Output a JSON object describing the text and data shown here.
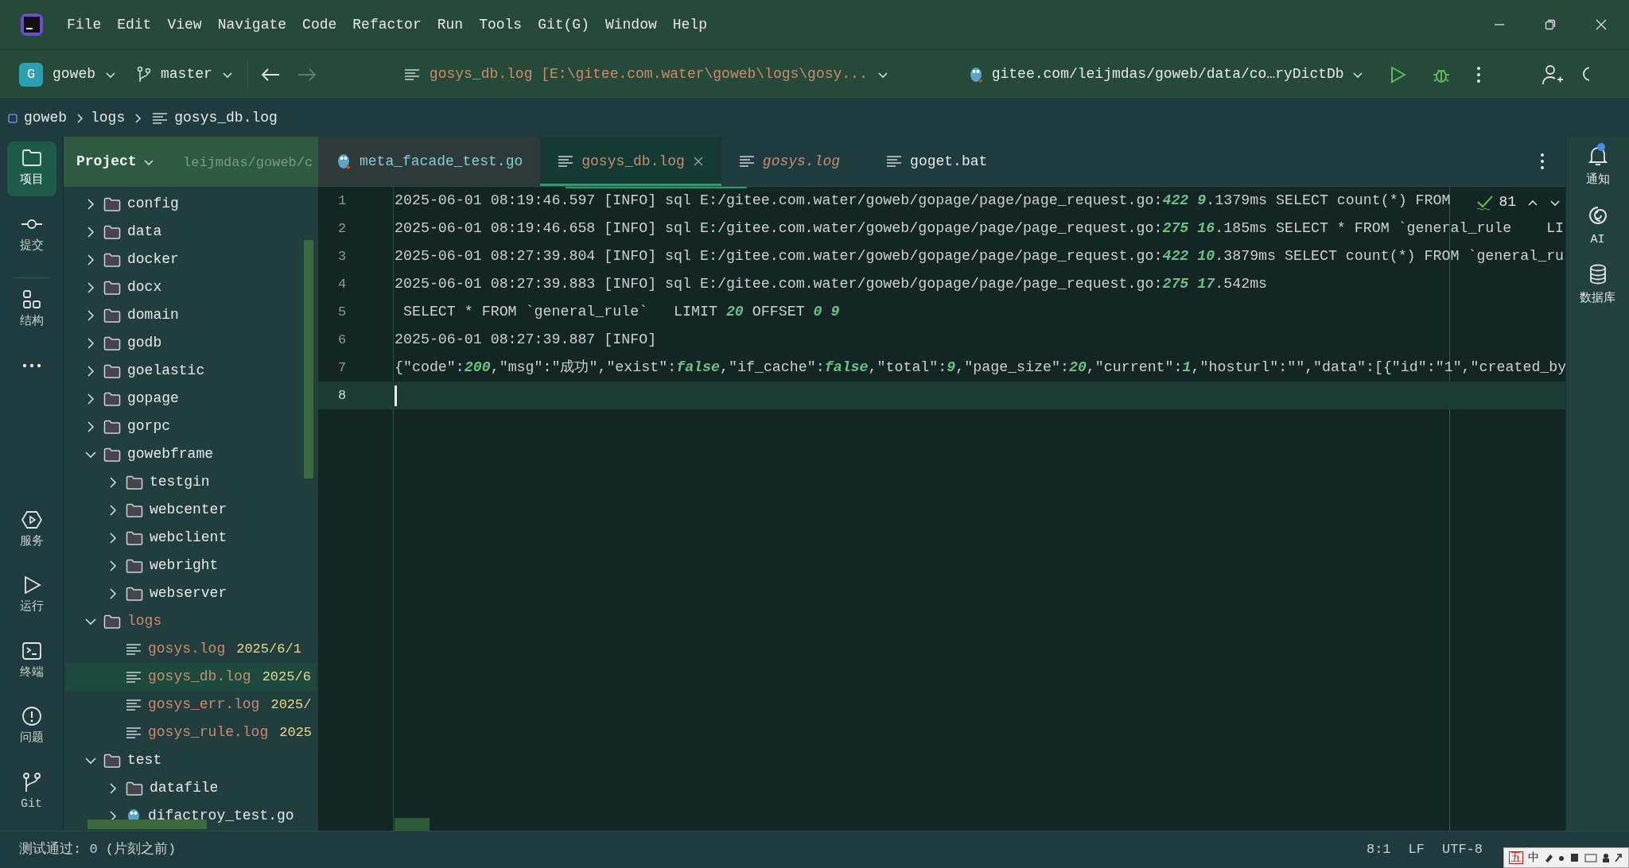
{
  "menu": [
    "File",
    "Edit",
    "View",
    "Navigate",
    "Code",
    "Refactor",
    "Run",
    "Tools",
    "Git(G)",
    "Window",
    "Help"
  ],
  "toolbar": {
    "project_badge": "G",
    "project": "goweb",
    "branch": "master",
    "recent_file": "gosys_db.log",
    "recent_path": "[E:\\gitee.com.water\\goweb\\logs\\gosy...",
    "run_config": "gitee.com/leijmdas/goweb/data/co…ryDictDb"
  },
  "breadcrumb": [
    "goweb",
    "logs",
    "gosys_db.log"
  ],
  "left_tools": [
    {
      "label": "项目",
      "kind": "folder",
      "selected": true
    },
    {
      "label": "提交",
      "kind": "commit",
      "selected": false
    },
    {
      "label": "结构",
      "kind": "structure",
      "selected": false
    },
    {
      "kind": "more",
      "selected": false
    },
    {
      "label": "服务",
      "kind": "services",
      "selected": false
    },
    {
      "label": "运行",
      "kind": "run",
      "selected": false
    },
    {
      "label": "终端",
      "kind": "terminal",
      "selected": false
    },
    {
      "label": "问题",
      "kind": "problems",
      "selected": false
    },
    {
      "label": "Git",
      "kind": "git",
      "selected": false
    }
  ],
  "project_panel": {
    "title": "Project",
    "ghost_texts": [
      "leijmdas/goweb/c"
    ],
    "tree": [
      {
        "name": "config",
        "kind": "folder",
        "expanded": false,
        "selected": false
      },
      {
        "name": "data",
        "kind": "folder",
        "expanded": false,
        "selected": false
      },
      {
        "name": "docker",
        "kind": "folder",
        "expanded": false,
        "selected": false
      },
      {
        "name": "docx",
        "kind": "folder",
        "expanded": false,
        "selected": false
      },
      {
        "name": "domain",
        "kind": "folder",
        "expanded": false,
        "selected": false
      },
      {
        "name": "godb",
        "kind": "folder",
        "expanded": false,
        "selected": false
      },
      {
        "name": "goelastic",
        "kind": "folder",
        "expanded": false,
        "selected": false
      },
      {
        "name": "gopage",
        "kind": "folder",
        "expanded": false,
        "selected": false
      },
      {
        "name": "gorpc",
        "kind": "folder",
        "expanded": false,
        "selected": false
      },
      {
        "name": "gowebframe",
        "kind": "folder",
        "expanded": true,
        "selected": false,
        "children": [
          {
            "name": "testgin",
            "kind": "folder",
            "expanded": false,
            "selected": false
          },
          {
            "name": "webcenter",
            "kind": "folder",
            "expanded": false,
            "selected": false
          },
          {
            "name": "webclient",
            "kind": "folder",
            "expanded": false,
            "selected": false
          },
          {
            "name": "webright",
            "kind": "folder",
            "expanded": false,
            "selected": false
          },
          {
            "name": "webserver",
            "kind": "folder",
            "expanded": false,
            "selected": false
          }
        ]
      },
      {
        "name": "logs",
        "kind": "folder",
        "expanded": true,
        "ignored": true,
        "selected": false,
        "children": [
          {
            "name": "gosys.log",
            "kind": "log",
            "ignored": true,
            "date": "2025/6/1",
            "selected": false
          },
          {
            "name": "gosys_db.log",
            "kind": "log",
            "ignored": true,
            "date": "2025/6",
            "selected": true
          },
          {
            "name": "gosys_err.log",
            "kind": "log",
            "ignored": true,
            "date": "2025/",
            "selected": false
          },
          {
            "name": "gosys_rule.log",
            "kind": "log",
            "ignored": true,
            "date": "2025",
            "selected": false
          }
        ]
      },
      {
        "name": "test",
        "kind": "folder",
        "expanded": true,
        "selected": false,
        "children": [
          {
            "name": "datafile",
            "kind": "folder",
            "expanded": false,
            "selected": false
          },
          {
            "name": "difactroy_test.go",
            "kind": "gofile",
            "expanded": false,
            "selected": false
          }
        ]
      }
    ]
  },
  "editor_tabs": [
    {
      "label": "meta_facade_test.go",
      "kind": "go",
      "selected": false,
      "preview": false
    },
    {
      "label": "gosys_db.log",
      "kind": "log",
      "selected": true,
      "preview": false
    },
    {
      "label": "gosys.log",
      "kind": "log",
      "selected": false,
      "preview": true
    },
    {
      "label": "goget.bat",
      "kind": "bat",
      "selected": false,
      "preview": false
    }
  ],
  "editor": {
    "inspection_count": "81",
    "lines": [
      {
        "number": "1",
        "current": false,
        "segments": [
          {
            "text": "2025-06-01 08:19:46.597 [INFO] sql E:/gitee.com.water/goweb/gopage/page/page_request.go:",
            "kind": "plain"
          },
          {
            "text": "422",
            "kind": "number"
          },
          {
            "text": " 9",
            "kind": "number"
          },
          {
            "text": ".1379ms SELECT count(*) FROM",
            "kind": "plain"
          }
        ]
      },
      {
        "number": "2",
        "current": false,
        "segments": [
          {
            "text": "2025-06-01 08:19:46.658 [INFO] sql E:/gitee.com.water/goweb/gopage/page/page_request.go:",
            "kind": "plain"
          },
          {
            "text": "275",
            "kind": "number"
          },
          {
            "text": " 16",
            "kind": "number"
          },
          {
            "text": ".185ms SELECT * FROM `general_rule    LI",
            "kind": "plain"
          }
        ]
      },
      {
        "number": "3",
        "current": false,
        "segments": [
          {
            "text": "2025-06-01 08:27:39.804 [INFO] sql E:/gitee.com.water/goweb/gopage/page/page_request.go:",
            "kind": "plain"
          },
          {
            "text": "422",
            "kind": "number"
          },
          {
            "text": " 10",
            "kind": "number"
          },
          {
            "text": ".3879ms SELECT count(*) FROM `general_ru",
            "kind": "plain"
          }
        ]
      },
      {
        "number": "4",
        "current": false,
        "segments": [
          {
            "text": "2025-06-01 08:27:39.883 [INFO] sql E:/gitee.com.water/goweb/gopage/page/page_request.go:",
            "kind": "plain"
          },
          {
            "text": "275",
            "kind": "number"
          },
          {
            "text": " 17",
            "kind": "number"
          },
          {
            "text": ".542ms",
            "kind": "plain"
          }
        ]
      },
      {
        "number": "5",
        "current": false,
        "segments": [
          {
            "text": " SELECT * FROM `general_rule`   LIMIT ",
            "kind": "plain"
          },
          {
            "text": "20",
            "kind": "number"
          },
          {
            "text": " OFFSET ",
            "kind": "plain"
          },
          {
            "text": "0 9",
            "kind": "number"
          }
        ]
      },
      {
        "number": "6",
        "current": false,
        "segments": [
          {
            "text": "2025-06-01 08:27:39.887 [INFO]",
            "kind": "plain"
          }
        ]
      },
      {
        "number": "7",
        "current": false,
        "segments": [
          {
            "text": "{\"code\":",
            "kind": "plain"
          },
          {
            "text": "200",
            "kind": "number"
          },
          {
            "text": ",\"msg\":\"成功\",\"exist\":",
            "kind": "plain"
          },
          {
            "text": "false",
            "kind": "number"
          },
          {
            "text": ",\"if_cache\":",
            "kind": "plain"
          },
          {
            "text": "false",
            "kind": "number"
          },
          {
            "text": ",\"total\":",
            "kind": "plain"
          },
          {
            "text": "9",
            "kind": "number"
          },
          {
            "text": ",\"page_size\":",
            "kind": "plain"
          },
          {
            "text": "20",
            "kind": "number"
          },
          {
            "text": ",\"current\":",
            "kind": "plain"
          },
          {
            "text": "1",
            "kind": "number"
          },
          {
            "text": ",\"hosturl\":\"\",\"data\":[{\"id\":\"1\",\"created_by",
            "kind": "plain"
          }
        ]
      },
      {
        "number": "8",
        "current": true
      }
    ]
  },
  "right_tools": [
    {
      "label": "通知",
      "kind": "bell",
      "badge": true
    },
    {
      "label": "AI",
      "kind": "ai",
      "badge": false
    },
    {
      "label": "数据库",
      "kind": "database",
      "badge": false
    }
  ],
  "status_bar": {
    "message": "测试通过: 0 (片刻之前)",
    "position": "8:1",
    "line_ending": "LF",
    "encoding": "UTF-8"
  },
  "language_bar": [
    "五",
    "中"
  ]
}
